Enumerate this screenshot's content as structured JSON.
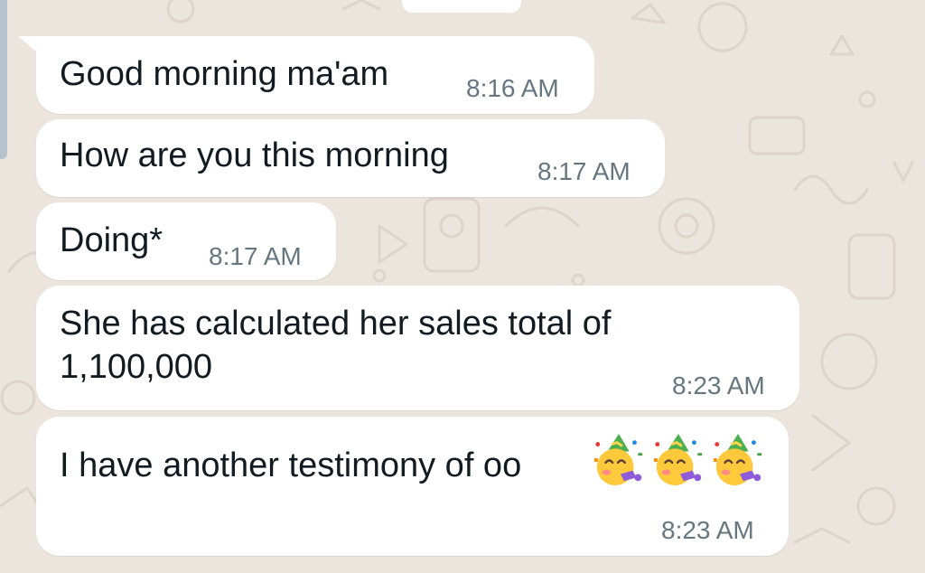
{
  "chat": {
    "messages": [
      {
        "text": "Good morning ma'am",
        "time": "8:16 AM"
      },
      {
        "text": "How are you this morning",
        "time": "8:17 AM"
      },
      {
        "text": "Doing*",
        "time": "8:17 AM"
      },
      {
        "text": "She has calculated her sales total of\n1,100,000",
        "time": "8:23 AM"
      },
      {
        "text": "I have another testimony of oo",
        "time": "8:23 AM",
        "emojis": [
          "partying-face-emoji",
          "partying-face-emoji",
          "partying-face-emoji"
        ]
      }
    ]
  },
  "colors": {
    "background": "#ece5dd",
    "bubble": "#ffffff",
    "text": "#111b21",
    "timestamp": "#667781",
    "scroll_indicator": "#b5c3cf"
  }
}
